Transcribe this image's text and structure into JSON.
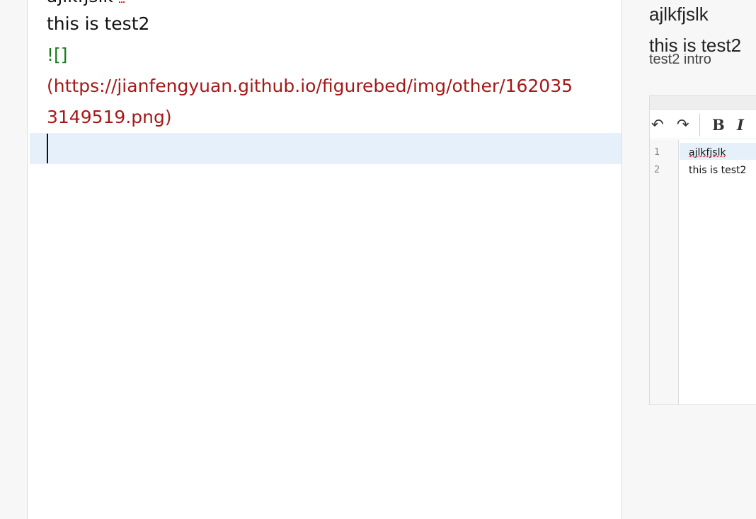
{
  "editor": {
    "clipped_line": "ajlkfjslk",
    "line1": "this is test2",
    "line2": "![]",
    "line3": "(https://jianfengyuan.github.io/figurebed/img/other/162035",
    "line4": "3149519.png)"
  },
  "preview": {
    "title": "ajlkfjslk",
    "heading": "this is test2",
    "clipped_text": "test2 intro"
  },
  "mini_editor": {
    "toolbar": {
      "undo_icon": "undo-icon",
      "redo_icon": "redo-icon",
      "bold_label": "B",
      "italic_label": "I"
    },
    "line_numbers": [
      "1",
      "2"
    ],
    "lines": [
      "ajlkfjslk",
      "this is test2"
    ]
  },
  "colors": {
    "markdown_image_syntax": "#1a7a1a",
    "markdown_url": "#a61818",
    "active_line": "#e6f0fb"
  }
}
